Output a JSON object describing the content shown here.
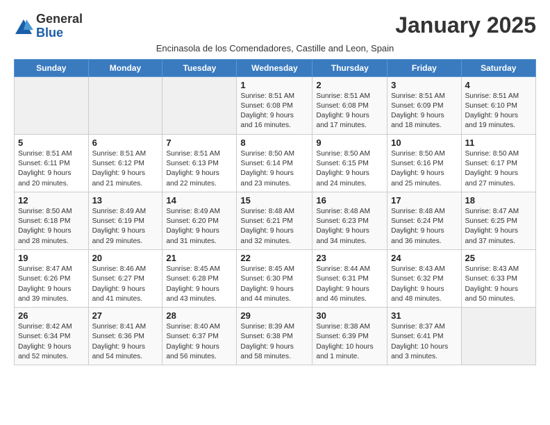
{
  "logo": {
    "general": "General",
    "blue": "Blue"
  },
  "header": {
    "title": "January 2025",
    "subtitle": "Encinasola de los Comendadores, Castille and Leon, Spain"
  },
  "weekdays": [
    "Sunday",
    "Monday",
    "Tuesday",
    "Wednesday",
    "Thursday",
    "Friday",
    "Saturday"
  ],
  "weeks": [
    [
      {
        "day": "",
        "info": ""
      },
      {
        "day": "",
        "info": ""
      },
      {
        "day": "",
        "info": ""
      },
      {
        "day": "1",
        "info": "Sunrise: 8:51 AM\nSunset: 6:08 PM\nDaylight: 9 hours\nand 16 minutes."
      },
      {
        "day": "2",
        "info": "Sunrise: 8:51 AM\nSunset: 6:08 PM\nDaylight: 9 hours\nand 17 minutes."
      },
      {
        "day": "3",
        "info": "Sunrise: 8:51 AM\nSunset: 6:09 PM\nDaylight: 9 hours\nand 18 minutes."
      },
      {
        "day": "4",
        "info": "Sunrise: 8:51 AM\nSunset: 6:10 PM\nDaylight: 9 hours\nand 19 minutes."
      }
    ],
    [
      {
        "day": "5",
        "info": "Sunrise: 8:51 AM\nSunset: 6:11 PM\nDaylight: 9 hours\nand 20 minutes."
      },
      {
        "day": "6",
        "info": "Sunrise: 8:51 AM\nSunset: 6:12 PM\nDaylight: 9 hours\nand 21 minutes."
      },
      {
        "day": "7",
        "info": "Sunrise: 8:51 AM\nSunset: 6:13 PM\nDaylight: 9 hours\nand 22 minutes."
      },
      {
        "day": "8",
        "info": "Sunrise: 8:50 AM\nSunset: 6:14 PM\nDaylight: 9 hours\nand 23 minutes."
      },
      {
        "day": "9",
        "info": "Sunrise: 8:50 AM\nSunset: 6:15 PM\nDaylight: 9 hours\nand 24 minutes."
      },
      {
        "day": "10",
        "info": "Sunrise: 8:50 AM\nSunset: 6:16 PM\nDaylight: 9 hours\nand 25 minutes."
      },
      {
        "day": "11",
        "info": "Sunrise: 8:50 AM\nSunset: 6:17 PM\nDaylight: 9 hours\nand 27 minutes."
      }
    ],
    [
      {
        "day": "12",
        "info": "Sunrise: 8:50 AM\nSunset: 6:18 PM\nDaylight: 9 hours\nand 28 minutes."
      },
      {
        "day": "13",
        "info": "Sunrise: 8:49 AM\nSunset: 6:19 PM\nDaylight: 9 hours\nand 29 minutes."
      },
      {
        "day": "14",
        "info": "Sunrise: 8:49 AM\nSunset: 6:20 PM\nDaylight: 9 hours\nand 31 minutes."
      },
      {
        "day": "15",
        "info": "Sunrise: 8:48 AM\nSunset: 6:21 PM\nDaylight: 9 hours\nand 32 minutes."
      },
      {
        "day": "16",
        "info": "Sunrise: 8:48 AM\nSunset: 6:23 PM\nDaylight: 9 hours\nand 34 minutes."
      },
      {
        "day": "17",
        "info": "Sunrise: 8:48 AM\nSunset: 6:24 PM\nDaylight: 9 hours\nand 36 minutes."
      },
      {
        "day": "18",
        "info": "Sunrise: 8:47 AM\nSunset: 6:25 PM\nDaylight: 9 hours\nand 37 minutes."
      }
    ],
    [
      {
        "day": "19",
        "info": "Sunrise: 8:47 AM\nSunset: 6:26 PM\nDaylight: 9 hours\nand 39 minutes."
      },
      {
        "day": "20",
        "info": "Sunrise: 8:46 AM\nSunset: 6:27 PM\nDaylight: 9 hours\nand 41 minutes."
      },
      {
        "day": "21",
        "info": "Sunrise: 8:45 AM\nSunset: 6:28 PM\nDaylight: 9 hours\nand 43 minutes."
      },
      {
        "day": "22",
        "info": "Sunrise: 8:45 AM\nSunset: 6:30 PM\nDaylight: 9 hours\nand 44 minutes."
      },
      {
        "day": "23",
        "info": "Sunrise: 8:44 AM\nSunset: 6:31 PM\nDaylight: 9 hours\nand 46 minutes."
      },
      {
        "day": "24",
        "info": "Sunrise: 8:43 AM\nSunset: 6:32 PM\nDaylight: 9 hours\nand 48 minutes."
      },
      {
        "day": "25",
        "info": "Sunrise: 8:43 AM\nSunset: 6:33 PM\nDaylight: 9 hours\nand 50 minutes."
      }
    ],
    [
      {
        "day": "26",
        "info": "Sunrise: 8:42 AM\nSunset: 6:34 PM\nDaylight: 9 hours\nand 52 minutes."
      },
      {
        "day": "27",
        "info": "Sunrise: 8:41 AM\nSunset: 6:36 PM\nDaylight: 9 hours\nand 54 minutes."
      },
      {
        "day": "28",
        "info": "Sunrise: 8:40 AM\nSunset: 6:37 PM\nDaylight: 9 hours\nand 56 minutes."
      },
      {
        "day": "29",
        "info": "Sunrise: 8:39 AM\nSunset: 6:38 PM\nDaylight: 9 hours\nand 58 minutes."
      },
      {
        "day": "30",
        "info": "Sunrise: 8:38 AM\nSunset: 6:39 PM\nDaylight: 10 hours\nand 1 minute."
      },
      {
        "day": "31",
        "info": "Sunrise: 8:37 AM\nSunset: 6:41 PM\nDaylight: 10 hours\nand 3 minutes."
      },
      {
        "day": "",
        "info": ""
      }
    ]
  ]
}
